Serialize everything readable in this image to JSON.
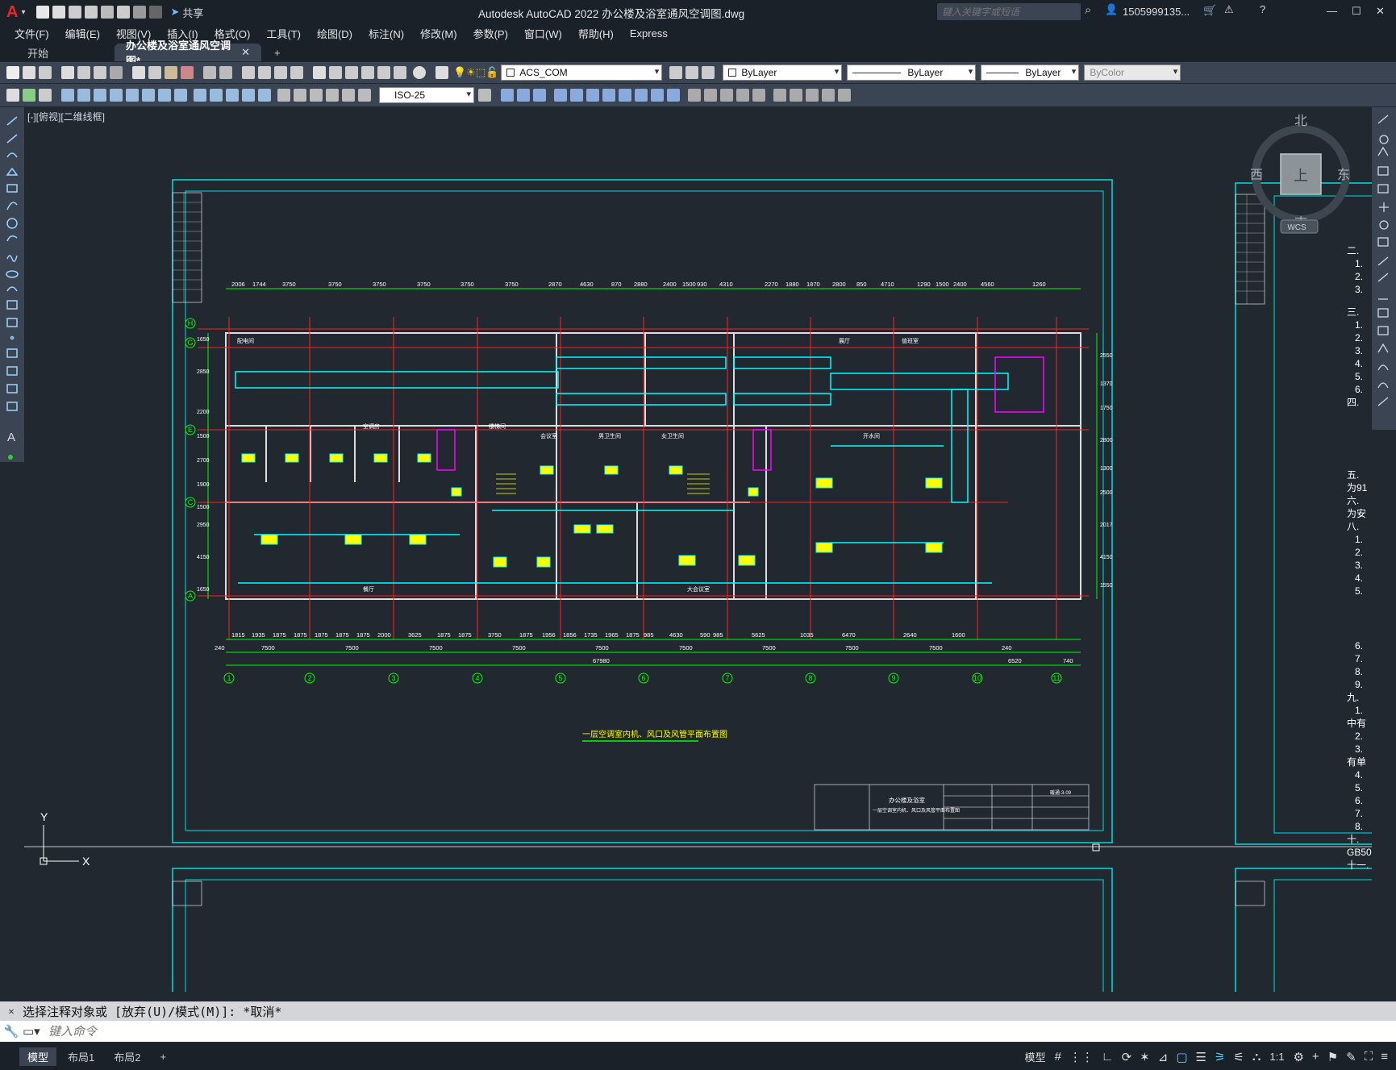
{
  "app": {
    "title": "Autodesk AutoCAD 2022    办公楼及浴室通风空调图.dwg",
    "logo": "A",
    "share": "共享",
    "search_placeholder": "键入关键字或短语",
    "user": "1505999135...",
    "window_controls": [
      "—",
      "☐",
      "✕"
    ]
  },
  "menu": [
    "文件(F)",
    "编辑(E)",
    "视图(V)",
    "插入(I)",
    "格式(O)",
    "工具(T)",
    "绘图(D)",
    "标注(N)",
    "修改(M)",
    "参数(P)",
    "窗口(W)",
    "帮助(H)",
    "Express"
  ],
  "tabs": [
    {
      "label": "开始"
    },
    {
      "label": "办公楼及浴室通风空调图*"
    }
  ],
  "properties": {
    "layer": "ACS_COM",
    "color": "ByLayer",
    "linetype": "ByLayer",
    "lineweight": "ByLayer",
    "plotstyle": "ByColor",
    "dimstyle": "ISO-25"
  },
  "viewport_label": "[-][俯视][二维线框]",
  "viewcube": {
    "n": "北",
    "s": "南",
    "e": "东",
    "w": "西",
    "top": "上",
    "wcs": "WCS"
  },
  "drawing": {
    "title": "一层空调室内机、风口及风管平面布置图",
    "grid_cols": [
      "1",
      "2",
      "3",
      "4",
      "5",
      "6",
      "7",
      "8",
      "9",
      "10",
      "11"
    ],
    "grid_rows": [
      "H",
      "G",
      "E",
      "C",
      "A"
    ],
    "bay_dims": [
      "7500",
      "7500",
      "7500",
      "7500",
      "7500",
      "7500",
      "7500",
      "7500",
      "7500"
    ],
    "total_dim": "67980",
    "top_dims": [
      "2006",
      "1744",
      "3750",
      "3750",
      "3750",
      "3750",
      "3750",
      "3750",
      "2870",
      "4630",
      "870",
      "2880",
      "2400",
      "1500",
      "930",
      "4310",
      "2270",
      "1880",
      "1870",
      "2800",
      "850",
      "4710",
      "1290",
      "1500",
      "2400",
      "4560",
      "1260"
    ],
    "bottom_dims": [
      "1815",
      "1935",
      "1875",
      "1875",
      "1875",
      "1875",
      "1875",
      "2000",
      "3625",
      "1875",
      "1875",
      "3750",
      "1875",
      "1956",
      "1856",
      "1735",
      "1965",
      "1875",
      "985",
      "4630",
      "590",
      "985",
      "5625",
      "1035",
      "6470",
      "2640",
      "1600"
    ],
    "end_dims": {
      "left": "240",
      "right": "240",
      "extra": "6520",
      "small": "740"
    },
    "left_dims": [
      "1650",
      "2850",
      "2200",
      "1500",
      "2700",
      "1900",
      "1500",
      "2950",
      "4150",
      "1650"
    ],
    "right_dims": [
      "2550",
      "1370",
      "1750",
      "2800",
      "1300",
      "2500",
      "2017",
      "4150",
      "1550"
    ],
    "room_labels": [
      "配电间",
      "空调房",
      "楼梯间",
      "会议室",
      "男卫生间",
      "女卫生间",
      "开水间",
      "餐厅",
      "大会议室",
      "展厅",
      "值班室"
    ],
    "title_block": {
      "project": "办公楼及浴室",
      "sheet": "一层空调室内机、风口及风管平面布置图",
      "num": "暖通-3-09"
    }
  },
  "right_sheet_notes": [
    "二.",
    "1.",
    "2.",
    "3.",
    "三.",
    "1.",
    "2.",
    "3.",
    "4.",
    "5.",
    "6.",
    "四.",
    "五.",
    "为91",
    "六.",
    "为安",
    "八.",
    "1.",
    "2.",
    "3.",
    "4.",
    "5.",
    "6.",
    "7.",
    "8.",
    "9.",
    "九.",
    "1.",
    "中有",
    "2.",
    "3.",
    "有单",
    "4.",
    "5.",
    "6.",
    "7.",
    "8.",
    "十.",
    "GB50",
    "十一."
  ],
  "ucs": {
    "x": "X",
    "y": "Y"
  },
  "command": {
    "history": "选择注释对象或 [放弃(U)/模式(M)]: *取消*",
    "placeholder": "键入命令"
  },
  "layout_tabs": [
    "模型",
    "布局1",
    "布局2"
  ],
  "status": {
    "model": "模型",
    "scale": "1:1"
  }
}
